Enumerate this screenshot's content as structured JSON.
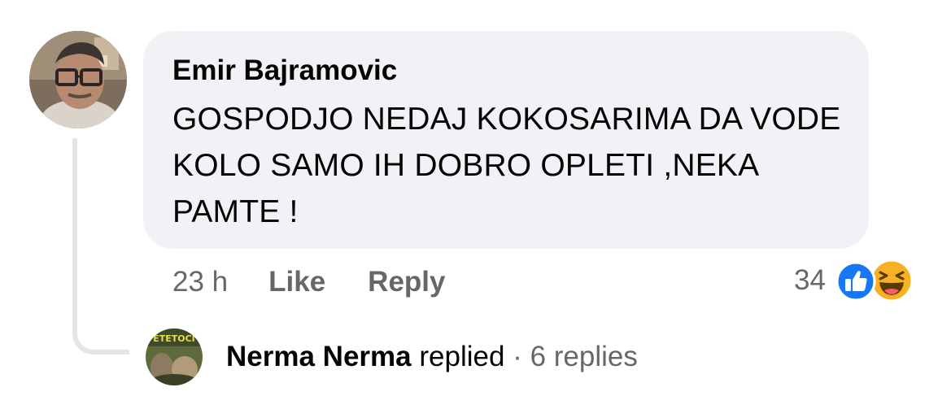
{
  "comment": {
    "author": "Emir Bajramovic",
    "text": "GOSPODJO NEDAJ KOKOSARIMA DA VODE KOLO SAMO IH DOBRO OPLETI ,NEKA PAMTE !",
    "timestamp": "23 h",
    "like_label": "Like",
    "reply_label": "Reply",
    "reaction_count": "34",
    "reactions": [
      "like-icon",
      "haha-icon"
    ],
    "avatar_icon": "profile-photo"
  },
  "replies": {
    "replier_name": "Nerma Nerma",
    "replied_label": "replied",
    "separator": "·",
    "count_label": "6 replies",
    "avatar_icon": "profile-photo",
    "avatar_text": "ETETOCI"
  },
  "colors": {
    "bubble_bg": "#f0f2f5",
    "text_primary": "#050505",
    "text_secondary": "#65676b",
    "like_blue": "#1877f2",
    "haha_yellow": "#f7b125",
    "thread_line": "#e3e5e8"
  }
}
